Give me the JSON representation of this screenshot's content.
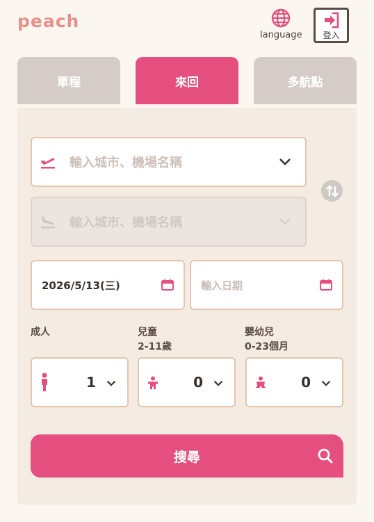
{
  "header": {
    "logo": "peach",
    "language_label": "language",
    "login_label": "登入"
  },
  "tabs": [
    {
      "label": "單程",
      "active": false
    },
    {
      "label": "來回",
      "active": true
    },
    {
      "label": "多航點",
      "active": false
    }
  ],
  "form": {
    "origin_placeholder": "輸入城市、機場名稱",
    "destination_placeholder": "輸入城市、機場名稱",
    "depart_date": "2026/5/13(三)",
    "return_placeholder": "輸入日期",
    "passengers": [
      {
        "label": "成人",
        "sub": "",
        "count": "1"
      },
      {
        "label": "兒童",
        "sub": "2-11歲",
        "count": "0"
      },
      {
        "label": "嬰幼兒",
        "sub": "0-23個月",
        "count": "0"
      }
    ],
    "search_label": "搜尋"
  },
  "colors": {
    "accent": "#e44f7f",
    "tab_inactive": "#d5ccc7",
    "field_border": "#e5c6ad",
    "panel_bg": "#f4ebe2"
  },
  "icons": [
    "globe-icon",
    "login-icon",
    "takeoff-icon",
    "landing-icon",
    "chevron-down-icon",
    "swap-icon",
    "calendar-icon",
    "adult-icon",
    "child-icon",
    "infant-icon",
    "search-icon"
  ]
}
